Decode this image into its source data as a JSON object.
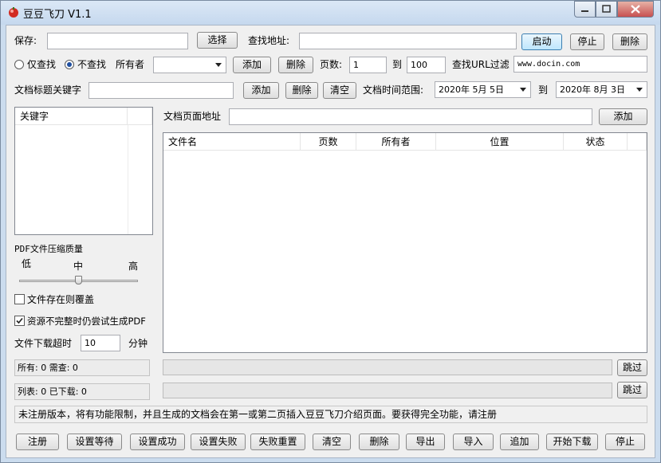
{
  "window": {
    "title": "豆豆飞刀 V1.1"
  },
  "row1": {
    "save_label": "保存:",
    "save_value": "",
    "select_button": "选择",
    "find_url_label": "查找地址:",
    "find_url_value": "",
    "start_button": "启动",
    "stop_button": "停止",
    "delete_button": "删除"
  },
  "row2": {
    "radio_only_find": "仅查找",
    "radio_no_find": "不查找",
    "radio_selected": "不查找",
    "owner_label": "所有者",
    "owner_value": "",
    "add_button": "添加",
    "delete_button": "删除",
    "pages_label": "页数:",
    "page_from": "1",
    "to_label": "到",
    "page_to": "100",
    "url_filter_label": "查找URL过滤",
    "url_filter_value": "www.docin.com"
  },
  "row3": {
    "keyword_label": "文档标题关键字",
    "keyword_value": "",
    "add_button": "添加",
    "delete_button": "删除",
    "clear_button": "清空",
    "date_range_label": "文档时间范围:",
    "date_from": "2020年 5月 5日",
    "to_label": "到",
    "date_to": "2020年 8月 3日"
  },
  "keyword_list": {
    "header": "关键字"
  },
  "doc_page": {
    "label": "文档页面地址",
    "value": "",
    "add_button": "添加"
  },
  "file_table": {
    "columns": [
      "文件名",
      "页数",
      "所有者",
      "位置",
      "状态"
    ]
  },
  "pdf_quality": {
    "title": "PDF文件压缩质量",
    "low": "低",
    "mid": "中",
    "high": "高",
    "level": 0.5
  },
  "options": {
    "overwrite_label": "文件存在则覆盖",
    "overwrite_checked": false,
    "incomplete_label": "资源不完整时仍尝试生成PDF",
    "incomplete_checked": true
  },
  "timeout": {
    "label": "文件下载超时",
    "value": "10",
    "unit": "分钟"
  },
  "status": {
    "line1": "所有: 0 需查: 0",
    "line2": "列表: 0 已下载: 0",
    "skip1": "跳过",
    "skip2": "跳过"
  },
  "notice": "未注册版本，将有功能限制，并且生成的文档会在第一或第二页插入豆豆飞刀介绍页面。要获得完全功能，请注册",
  "bottom_buttons": {
    "register": "注册",
    "set_waiting": "设置等待",
    "set_success": "设置成功",
    "set_failed": "设置失败",
    "reset_failed": "失败重置",
    "clear": "清空",
    "delete": "删除",
    "export": "导出",
    "import": "导入",
    "append": "追加",
    "start_download": "开始下载",
    "stop": "停止"
  },
  "icons": {
    "app": "red-bean-icon",
    "minimize": "minimize-icon",
    "maximize": "maximize-icon",
    "close": "close-icon"
  }
}
